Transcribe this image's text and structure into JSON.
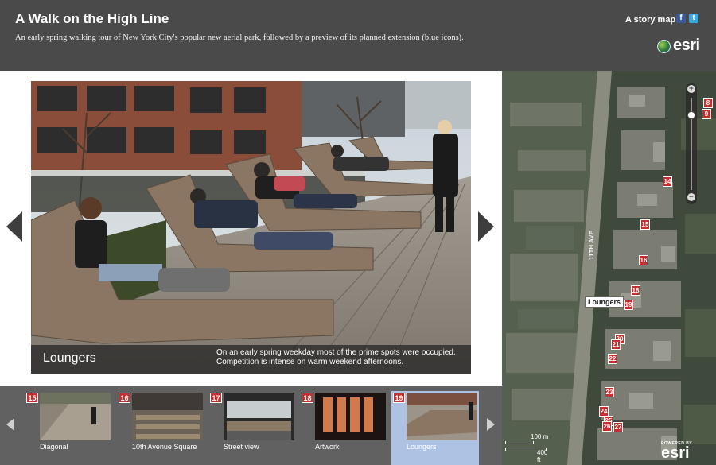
{
  "header": {
    "title": "A Walk on the High Line",
    "subtitle": "An early spring walking tour of New York City's popular new aerial park, followed by a preview of its planned extension (blue icons).",
    "story_map_label": "A story map",
    "facebook_glyph": "f",
    "twitter_glyph": "t",
    "logo_text": "esri"
  },
  "main": {
    "caption_title": "Loungers",
    "caption_lines": [
      "On an early spring weekday most of the prime spots were occupied.",
      "Competition is intense on warm weekend afternoons."
    ]
  },
  "carousel": {
    "items": [
      {
        "num": "15",
        "label": "Diagonal"
      },
      {
        "num": "16",
        "label": "10th Avenue Square"
      },
      {
        "num": "17",
        "label": "Street view"
      },
      {
        "num": "18",
        "label": "Artwork"
      },
      {
        "num": "19",
        "label": "Loungers",
        "selected": true
      }
    ]
  },
  "map": {
    "tooltip": "Loungers",
    "avenue_label": "11TH AVE",
    "markers": [
      "8",
      "9",
      "14",
      "15",
      "16",
      "18",
      "19",
      "20",
      "21",
      "22",
      "23",
      "24",
      "25",
      "26",
      "27"
    ],
    "zoom_in": "+",
    "zoom_out": "−",
    "scale_small": "100 m",
    "scale_large": "400 ft",
    "powered_by": "POWERED BY",
    "powered_logo": "esri"
  },
  "colors": {
    "header_bg": "#4a4a4a",
    "carousel_bg": "#616161",
    "selected_thumb": "#aec3e4",
    "marker_red": "#c62f2f"
  }
}
